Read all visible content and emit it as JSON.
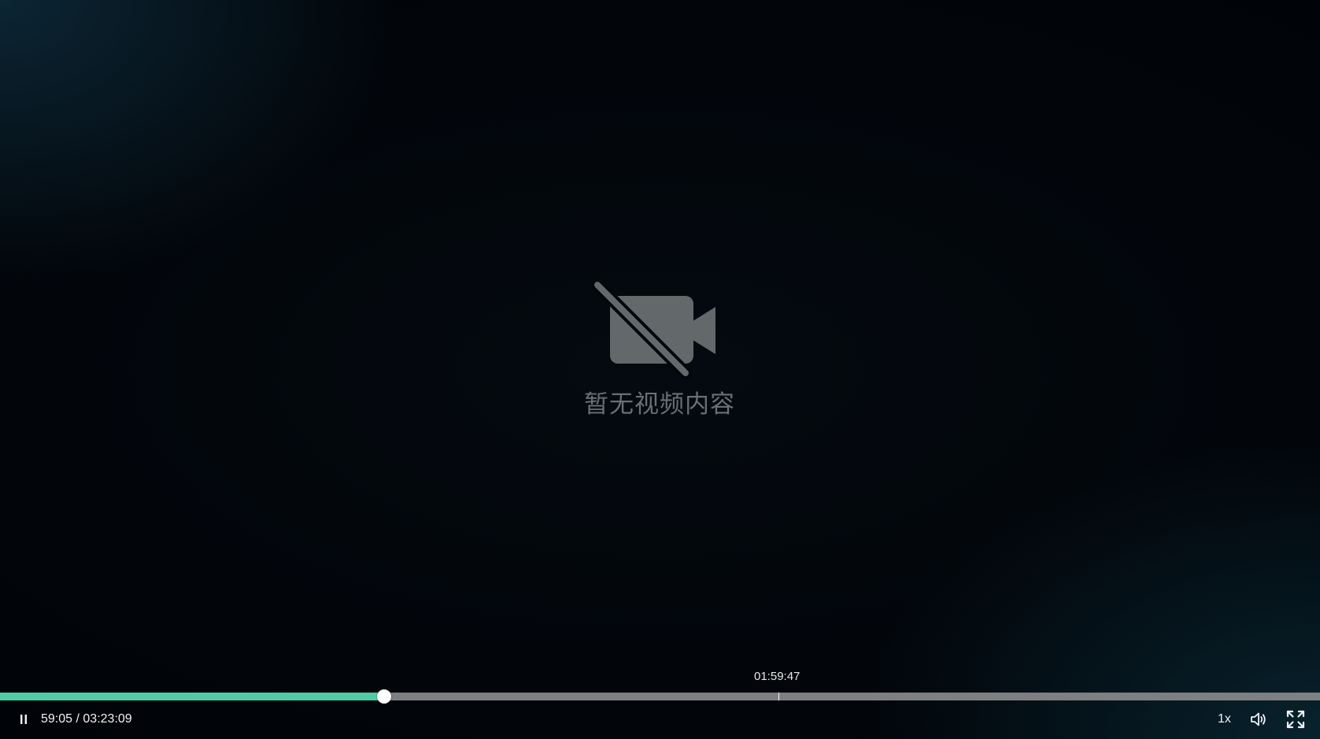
{
  "empty_state": {
    "icon": "video-off-icon",
    "message": "暂无视频内容"
  },
  "playback": {
    "current_time": "59:05",
    "separator": "/",
    "duration": "03:23:09",
    "progress_fraction": 0.2907,
    "hover_time": "01:59:47",
    "hover_fraction": 0.5899,
    "state_icon": "pause-icon"
  },
  "controls": {
    "speed_label": "1x",
    "volume_icon": "volume-icon",
    "fullscreen_icon": "fullscreen-icon"
  },
  "colors": {
    "progress_played": "#4fcca5",
    "progress_track": "#7d7f81",
    "icon_gray": "#6b6f72"
  }
}
